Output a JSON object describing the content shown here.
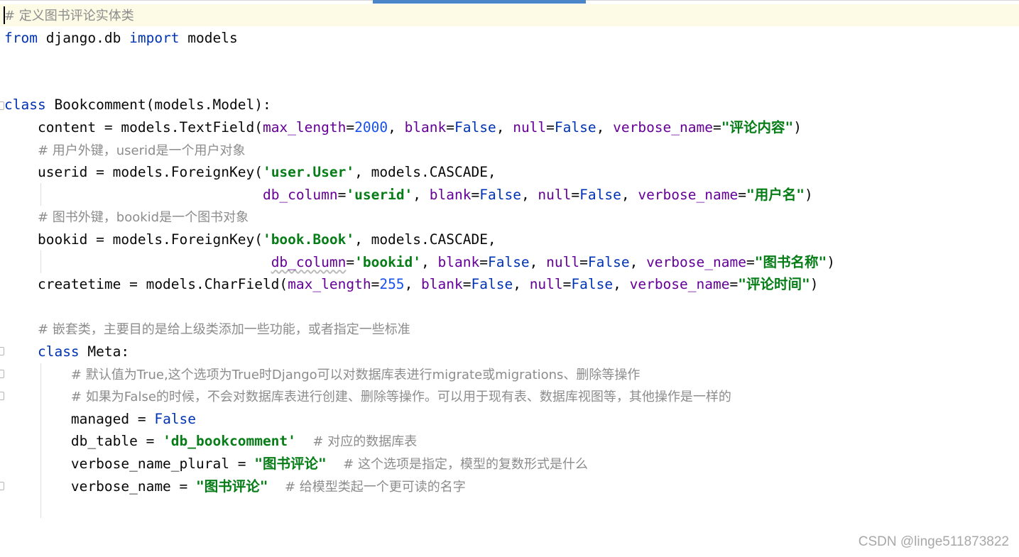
{
  "editor": {
    "lines": [
      {
        "t": [
          [
            "cmt",
            "# 定义图书评论实体类"
          ]
        ]
      },
      {
        "t": [
          [
            "kw",
            "from"
          ],
          [
            "",
            " django.db "
          ],
          [
            "kw",
            "import"
          ],
          [
            "",
            " models"
          ]
        ]
      },
      {
        "t": []
      },
      {
        "t": []
      },
      {
        "t": [
          [
            "kw",
            "class"
          ],
          [
            "",
            " Bookcomment(models.Model):"
          ]
        ]
      },
      {
        "t": [
          [
            "",
            "    content = models.TextField("
          ],
          [
            "param",
            "max_length"
          ],
          [
            "",
            "="
          ],
          [
            "num",
            "2000"
          ],
          [
            "",
            ", "
          ],
          [
            "param",
            "blank"
          ],
          [
            "",
            "="
          ],
          [
            "kw",
            "False"
          ],
          [
            "",
            ", "
          ],
          [
            "param",
            "null"
          ],
          [
            "",
            "="
          ],
          [
            "kw",
            "False"
          ],
          [
            "",
            ", "
          ],
          [
            "param",
            "verbose_name"
          ],
          [
            "",
            "="
          ],
          [
            "str",
            "\"评论内容\""
          ],
          [
            "",
            ")"
          ]
        ]
      },
      {
        "t": [
          [
            "",
            "    "
          ],
          [
            "cmt",
            "# 用户外键，userid是一个用户对象"
          ]
        ]
      },
      {
        "t": [
          [
            "",
            "    userid = models.ForeignKey("
          ],
          [
            "str",
            "'user.User'"
          ],
          [
            "",
            ", models.CASCADE,"
          ]
        ]
      },
      {
        "t": [
          [
            "",
            "                               "
          ],
          [
            "param",
            "db_column"
          ],
          [
            "",
            "="
          ],
          [
            "str",
            "'userid'"
          ],
          [
            "",
            ", "
          ],
          [
            "param",
            "blank"
          ],
          [
            "",
            "="
          ],
          [
            "kw",
            "False"
          ],
          [
            "",
            ", "
          ],
          [
            "param",
            "null"
          ],
          [
            "",
            "="
          ],
          [
            "kw",
            "False"
          ],
          [
            "",
            ", "
          ],
          [
            "param",
            "verbose_name"
          ],
          [
            "",
            "="
          ],
          [
            "str",
            "\"用户名\""
          ],
          [
            "",
            ")"
          ]
        ]
      },
      {
        "t": [
          [
            "",
            "    "
          ],
          [
            "cmt",
            "# 图书外键，bookid是一个图书对象"
          ]
        ]
      },
      {
        "t": [
          [
            "",
            "    bookid = models.ForeignKey("
          ],
          [
            "str",
            "'book.Book'"
          ],
          [
            "",
            ", models.CASCADE,"
          ]
        ]
      },
      {
        "t": [
          [
            "",
            "                                "
          ],
          [
            "param squiggle",
            "db_column"
          ],
          [
            "",
            "="
          ],
          [
            "str",
            "'bookid'"
          ],
          [
            "",
            ", "
          ],
          [
            "param",
            "blank"
          ],
          [
            "",
            "="
          ],
          [
            "kw",
            "False"
          ],
          [
            "",
            ", "
          ],
          [
            "param",
            "null"
          ],
          [
            "",
            "="
          ],
          [
            "kw",
            "False"
          ],
          [
            "",
            ", "
          ],
          [
            "param",
            "verbose_name"
          ],
          [
            "",
            "="
          ],
          [
            "str",
            "\"图书名称\""
          ],
          [
            "",
            ")"
          ]
        ]
      },
      {
        "t": [
          [
            "",
            "    createtime = models.CharField("
          ],
          [
            "param",
            "max_length"
          ],
          [
            "",
            "="
          ],
          [
            "num",
            "255"
          ],
          [
            "",
            ", "
          ],
          [
            "param",
            "blank"
          ],
          [
            "",
            "="
          ],
          [
            "kw",
            "False"
          ],
          [
            "",
            ", "
          ],
          [
            "param",
            "null"
          ],
          [
            "",
            "="
          ],
          [
            "kw",
            "False"
          ],
          [
            "",
            ", "
          ],
          [
            "param",
            "verbose_name"
          ],
          [
            "",
            "="
          ],
          [
            "str",
            "\"评论时间\""
          ],
          [
            "",
            ")"
          ]
        ]
      },
      {
        "t": []
      },
      {
        "t": [
          [
            "",
            "    "
          ],
          [
            "cmt",
            "# 嵌套类，主要目的是给上级类添加一些功能，或者指定一些标准"
          ]
        ]
      },
      {
        "t": [
          [
            "",
            "    "
          ],
          [
            "kw",
            "class"
          ],
          [
            "",
            " Meta:"
          ]
        ]
      },
      {
        "t": [
          [
            "",
            "        "
          ],
          [
            "cmt",
            "# 默认值为True,这个选项为True时Django可以对数据库表进行migrate或migrations、删除等操作"
          ]
        ]
      },
      {
        "t": [
          [
            "",
            "        "
          ],
          [
            "cmt",
            "# 如果为False的时候，不会对数据库表进行创建、删除等操作。可以用于现有表、数据库视图等，其他操作是一样的"
          ]
        ]
      },
      {
        "t": [
          [
            "",
            "        managed = "
          ],
          [
            "kw",
            "False"
          ]
        ]
      },
      {
        "t": [
          [
            "",
            "        db_table = "
          ],
          [
            "str",
            "'db_bookcomment'"
          ],
          [
            "",
            "  "
          ],
          [
            "cmt",
            "# 对应的数据库表"
          ]
        ]
      },
      {
        "t": [
          [
            "",
            "        verbose_name_plural = "
          ],
          [
            "str",
            "\"图书评论\""
          ],
          [
            "",
            "  "
          ],
          [
            "cmt",
            "# 这个选项是指定，模型的复数形式是什么"
          ]
        ]
      },
      {
        "t": [
          [
            "",
            "        verbose_name = "
          ],
          [
            "str",
            "\"图书评论\""
          ],
          [
            "",
            "  "
          ],
          [
            "cmt",
            "# 给模型类起一个更可读的名字"
          ]
        ]
      }
    ]
  },
  "watermark": "CSDN @linge511873822"
}
